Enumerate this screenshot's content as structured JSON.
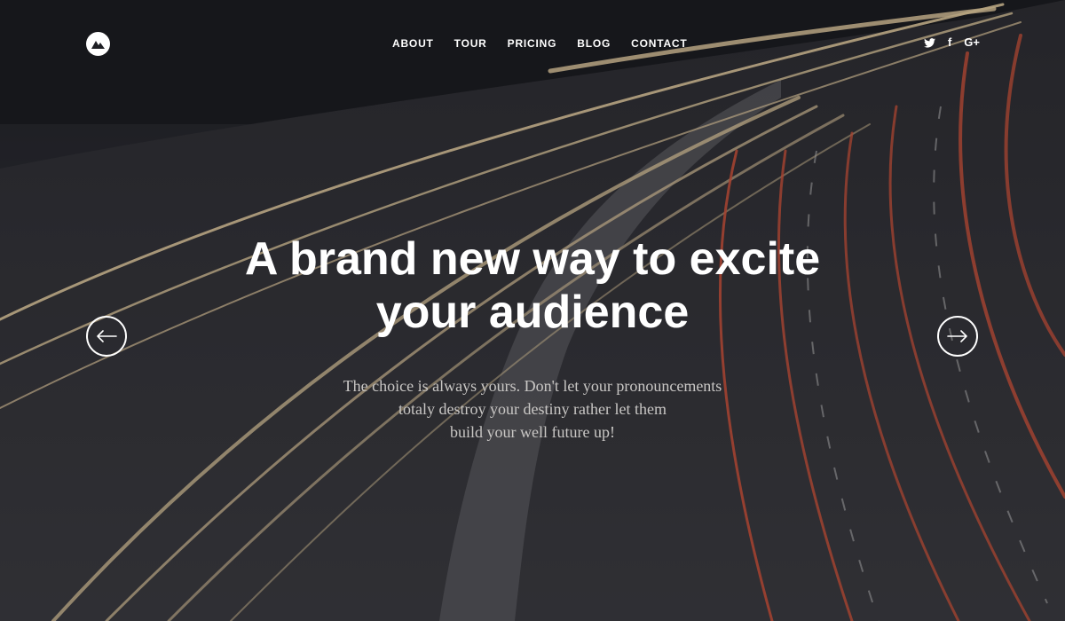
{
  "header": {
    "logo_icon": "mountain-logo-icon",
    "nav": [
      {
        "label": "ABOUT"
      },
      {
        "label": "TOUR"
      },
      {
        "label": "PRICING"
      },
      {
        "label": "BLOG"
      },
      {
        "label": "CONTACT"
      }
    ],
    "social": [
      {
        "icon": "twitter-icon"
      },
      {
        "icon": "facebook-icon",
        "glyph": "f"
      },
      {
        "icon": "google-plus-icon",
        "glyph": "G+"
      }
    ]
  },
  "hero": {
    "headline_lines": [
      "A brand new way to excite",
      "your audience"
    ],
    "subtext_lines": [
      "The choice is always yours. Don't let your pronouncements",
      "totaly destroy your destiny rather let them",
      "build your well future up!"
    ],
    "prev_icon": "arrow-left-icon",
    "next_icon": "arrow-right-icon"
  },
  "colors": {
    "text": "#ffffff",
    "subtext": "#c9c7c5",
    "light_trail_warm": "#f3d9a8",
    "light_trail_red": "#e0553a"
  }
}
